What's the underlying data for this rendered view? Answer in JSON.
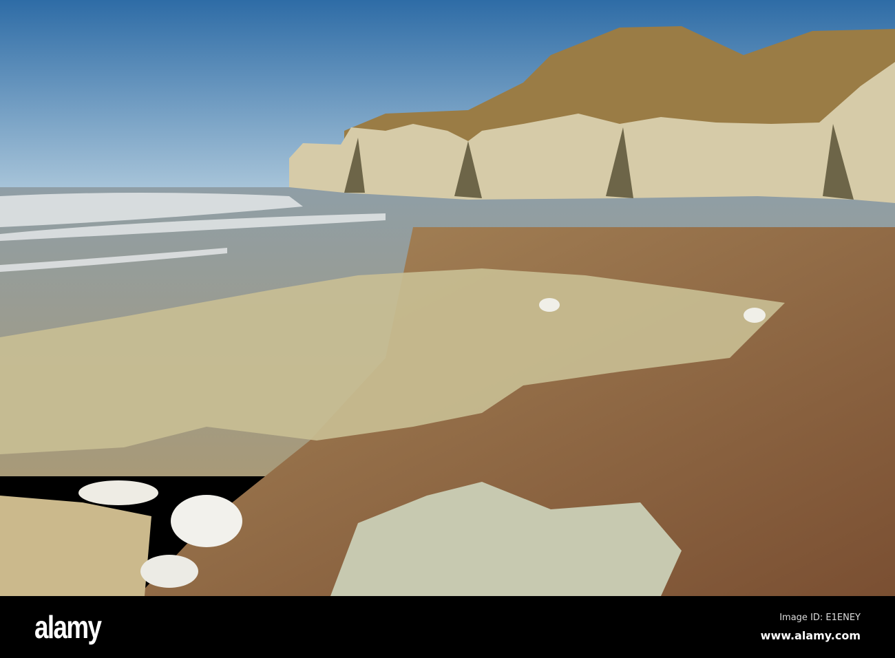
{
  "photo": {
    "subject": "chalk cliffs and rocky beach",
    "colors": {
      "sky_top": "#2f6fa8",
      "sky_bottom": "#a8c6dc",
      "sea": "#8a8f8a",
      "cliff": "#d9cfb0",
      "grass": "#9a7e45",
      "beach": "#8b5e3c",
      "rock": "#c9c3a0"
    }
  },
  "footer": {
    "logo": "alamy",
    "image_id": "Image ID: E1ENEY",
    "website": "www.alamy.com"
  }
}
